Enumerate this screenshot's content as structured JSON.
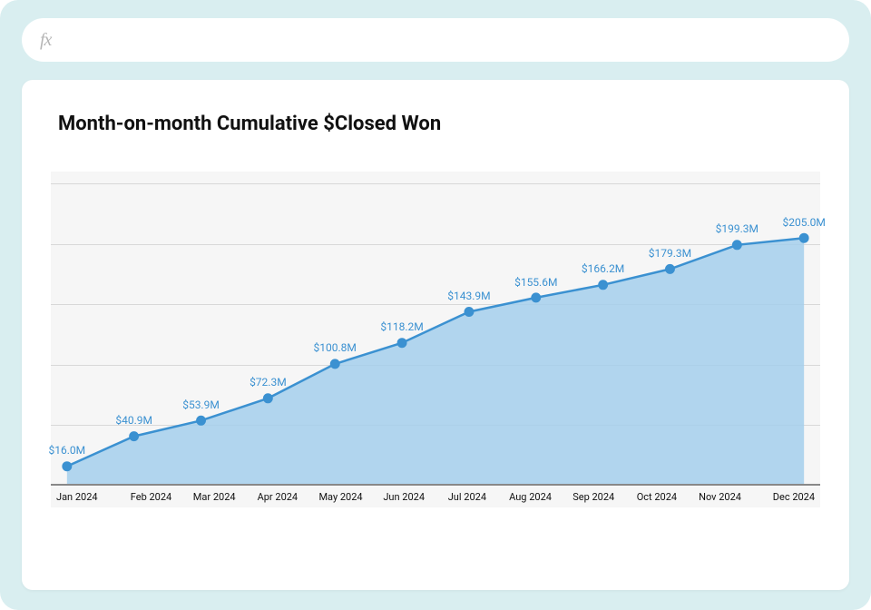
{
  "chart_data": {
    "type": "area",
    "title": "Month-on-month Cumulative $Closed Won",
    "categories": [
      "Jan 2024",
      "Feb 2024",
      "Mar 2024",
      "Apr 2024",
      "May 2024",
      "Jun 2024",
      "Jul 2024",
      "Aug 2024",
      "Sep 2024",
      "Oct 2024",
      "Nov 2024",
      "Dec 2024"
    ],
    "values": [
      16.0,
      40.9,
      53.9,
      72.3,
      100.8,
      118.2,
      143.9,
      155.6,
      166.2,
      179.3,
      199.3,
      205.0
    ],
    "value_labels": [
      "$16.0M",
      "$40.9M",
      "$53.9M",
      "$72.3M",
      "$100.8M",
      "$118.2M",
      "$143.9M",
      "$155.6M",
      "$166.2M",
      "$179.3M",
      "$199.3M",
      "$205.0M"
    ],
    "ylim": [
      0,
      260
    ],
    "gridlines_y": [
      50,
      100,
      150,
      200,
      250
    ],
    "xlabel": "",
    "ylabel": ""
  },
  "formula_bar": {
    "icon_text": "fx"
  }
}
